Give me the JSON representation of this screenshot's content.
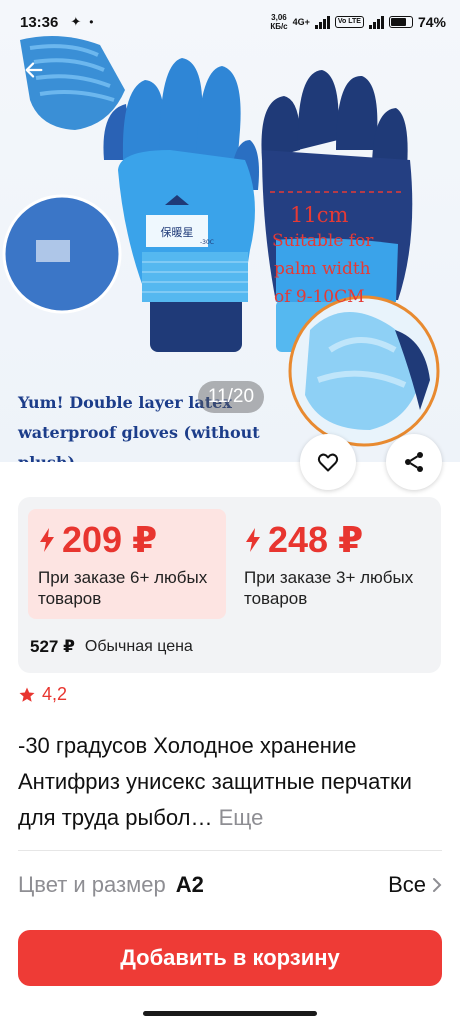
{
  "status_bar": {
    "time": "13:36",
    "speed_value": "3,06",
    "speed_unit": "КБ/с",
    "network": "4G+",
    "volte": "Vo LTE",
    "battery": "74%",
    "battery_level": 0.74
  },
  "gallery": {
    "image_counter": "11/20",
    "caption": "Yum! Double layer latex waterproof gloves (without plush)",
    "annotation_size": "11cm",
    "annotation_text": "Suitable for palm width of 9-10CM",
    "brand_text": "保暖星",
    "tag_text": "-30C"
  },
  "prices": {
    "tiers": [
      {
        "price": "209 ₽",
        "condition": "При заказе 6+ любых товаров",
        "highlighted": true
      },
      {
        "price": "248 ₽",
        "condition": "При заказе 3+ любых товаров",
        "highlighted": false
      }
    ],
    "regular_price": "527 ₽",
    "regular_label": "Обычная цена"
  },
  "rating": {
    "value": "4,2"
  },
  "product": {
    "title": "-30 градусов Холодное хранение Антифриз унисекс защитные перчатки для труда рыбол…",
    "more_label": "Еще"
  },
  "variant": {
    "label": "Цвет и размер",
    "value": "A2",
    "all_label": "Все"
  },
  "cart": {
    "button_label": "Добавить в корзину"
  },
  "colors": {
    "accent": "#ee3b36",
    "price_red": "#e8352f",
    "tier_highlight_bg": "#fde4e2",
    "card_bg": "#f2f3f5",
    "muted": "#8e8e93",
    "glove_blue": "#2f9ae0",
    "glove_navy": "#1f3a78"
  },
  "icons": {
    "back": "arrow-left-icon",
    "favorite": "heart-icon",
    "share": "share-icon",
    "price_flash": "lightning-icon",
    "rating": "star-icon",
    "chevron": "chevron-right-icon"
  }
}
